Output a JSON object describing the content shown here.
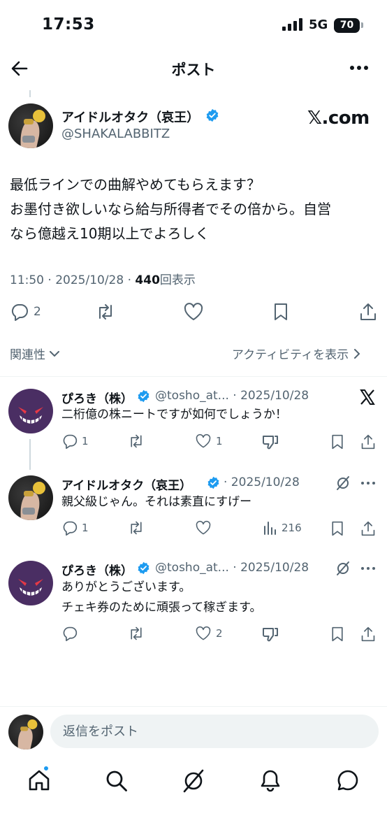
{
  "status_bar": {
    "time": "17:53",
    "network": "5G",
    "battery": "70"
  },
  "header": {
    "title": "ポスト"
  },
  "post": {
    "author_name": "アイドルオタク（哀王）",
    "author_handle": "@SHAKALABBITZ",
    "source_label": "𝕏.com",
    "text_lines": [
      "最低ラインでの曲解やめてもらえます？",
      "お墨付き欲しいなら給与所得者でその倍から。自営",
      "なら億越え10期以上でよろしく"
    ],
    "timestamp": "11:50 · 2025/10/28 · ",
    "views_count": "440",
    "views_label": "回表示",
    "reply_count": "2"
  },
  "sort": {
    "relevance_label": "関連性",
    "activity_label": "アクティビティを表示"
  },
  "replies": [
    {
      "name": "ぴろき（株）",
      "handle_date": "@tosho_at... · 2025/10/28",
      "text_lines": [
        "二桁億の株ニートですが如何でしょうか！"
      ],
      "reply_count": "1",
      "like_count": "1"
    },
    {
      "name": "アイドルオタク（哀王）",
      "handle_date": "· 2025/10/28",
      "text_lines": [
        "親父級じゃん。それは素直にすげー"
      ],
      "reply_count": "1",
      "views_count": "216"
    },
    {
      "name": "ぴろき（株）",
      "handle_date": "@tosho_at... · 2025/10/28",
      "text_lines": [
        "ありがとうございます。",
        "チェキ券のために頑張って稼ぎます。"
      ],
      "like_count": "2"
    }
  ],
  "compose": {
    "placeholder": "返信をポスト"
  },
  "colors": {
    "accent": "#1d9bf0",
    "text": "#0f1419",
    "secondary": "#536471",
    "ghost_avatar": "#4a2e63"
  },
  "icons": [
    "back-arrow-icon",
    "more-icon",
    "verified-badge-icon",
    "x-logo-icon",
    "reply-icon",
    "repost-icon",
    "like-icon",
    "bookmark-icon",
    "share-icon",
    "dislike-icon",
    "grok-icon",
    "views-icon",
    "home-icon",
    "search-icon",
    "bell-icon",
    "messages-icon"
  ]
}
